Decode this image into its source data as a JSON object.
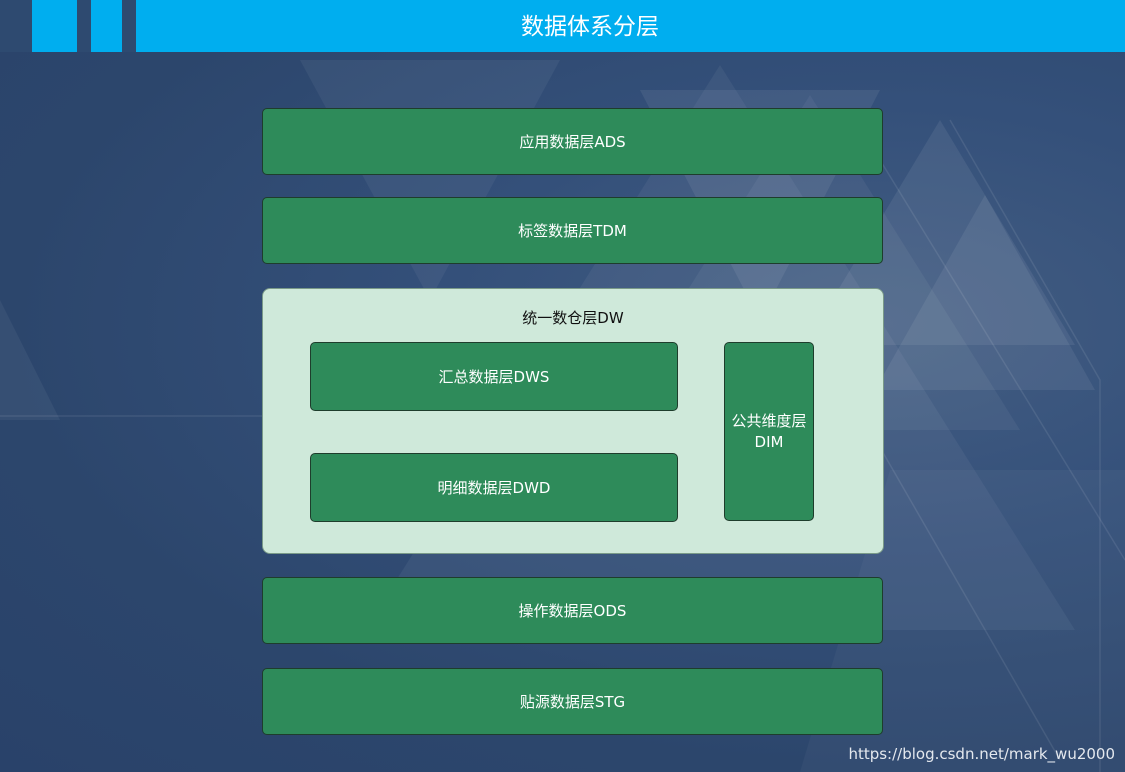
{
  "title": "数据体系分层",
  "layers_top": [
    {
      "id": "ads",
      "label": "应用数据层ADS"
    },
    {
      "id": "tdm",
      "label": "标签数据层TDM"
    }
  ],
  "dw": {
    "title": "统一数仓层DW",
    "dws_label": "汇总数据层DWS",
    "dwd_label": "明细数据层DWD",
    "dim_line1": "公共维度层",
    "dim_line2": "DIM"
  },
  "layers_bottom": [
    {
      "id": "ods",
      "label": "操作数据层ODS"
    },
    {
      "id": "stg",
      "label": "贴源数据层STG"
    }
  ],
  "watermark": "https://blog.csdn.net/mark_wu2000",
  "colors": {
    "header": "#00aeef",
    "background": "#2e4a70",
    "layer_box": "#2e8b5a",
    "dw_container": "#cfe9da"
  }
}
